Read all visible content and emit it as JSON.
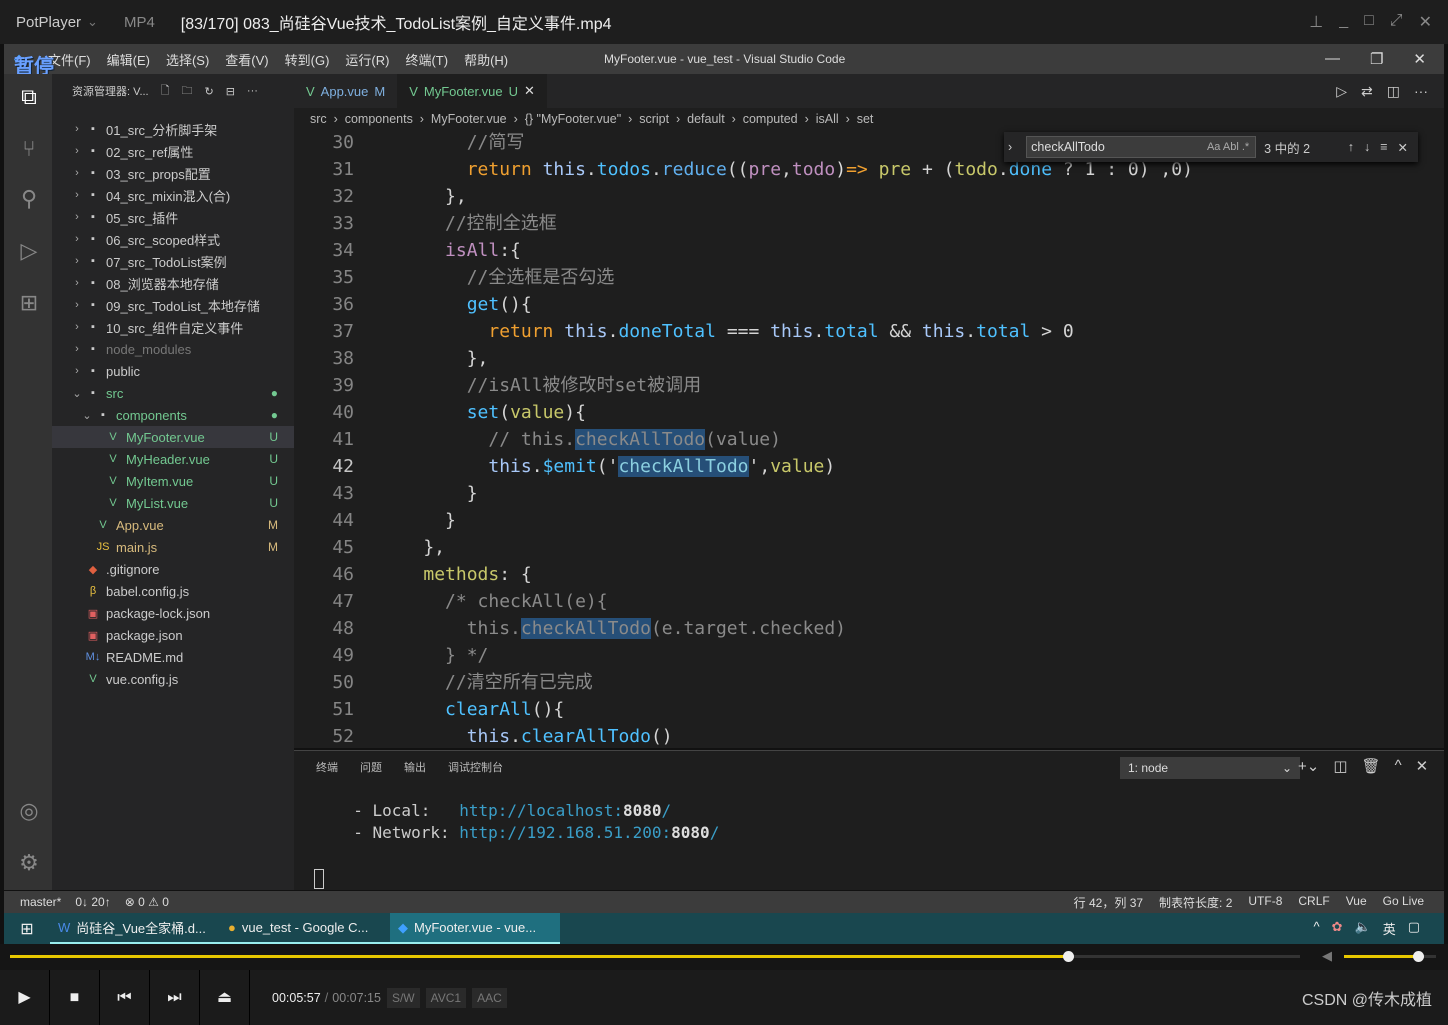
{
  "player": {
    "brand": "PotPlayer",
    "format": "MP4",
    "title": "[83/170] 083_尚硅谷Vue技术_TodoList案例_自定义事件.mp4",
    "pause_overlay": "暂停",
    "time_current": "00:05:57",
    "time_total": "00:07:15",
    "badges": [
      "S/W",
      "AVC1",
      "AAC"
    ],
    "progress_fraction": 0.82,
    "volume_fraction": 0.8,
    "watermark": "CSDN @传木成植",
    "accent": "#e8c800"
  },
  "vscode": {
    "menu": [
      "文件(F)",
      "编辑(E)",
      "选择(S)",
      "查看(V)",
      "转到(G)",
      "运行(R)",
      "终端(T)",
      "帮助(H)"
    ],
    "window_title": "MyFooter.vue - vue_test - Visual Studio Code",
    "explorer_title": "资源管理器: V...",
    "files": [
      {
        "label": "01_src_分析脚手架",
        "type": "folder",
        "level": 0
      },
      {
        "label": "02_src_ref属性",
        "type": "folder",
        "level": 0
      },
      {
        "label": "03_src_props配置",
        "type": "folder",
        "level": 0
      },
      {
        "label": "04_src_mixin混入(合)",
        "type": "folder",
        "level": 0
      },
      {
        "label": "05_src_插件",
        "type": "folder",
        "level": 0
      },
      {
        "label": "06_src_scoped样式",
        "type": "folder",
        "level": 0
      },
      {
        "label": "07_src_TodoList案例",
        "type": "folder",
        "level": 0
      },
      {
        "label": "08_浏览器本地存储",
        "type": "folder",
        "level": 0
      },
      {
        "label": "09_src_TodoList_本地存储",
        "type": "folder",
        "level": 0
      },
      {
        "label": "10_src_组件自定义事件",
        "type": "folder",
        "level": 0
      },
      {
        "label": "node_modules",
        "type": "folder",
        "level": 0,
        "dim": true
      },
      {
        "label": "public",
        "type": "folder",
        "level": 0
      },
      {
        "label": "src",
        "type": "folder-open",
        "level": 0,
        "badge": "●",
        "color": "green"
      },
      {
        "label": "components",
        "type": "folder-open",
        "level": 1,
        "badge": "●",
        "color": "green"
      },
      {
        "label": "MyFooter.vue",
        "type": "vue",
        "level": 2,
        "badge": "U",
        "color": "green",
        "selected": true
      },
      {
        "label": "MyHeader.vue",
        "type": "vue",
        "level": 2,
        "badge": "U",
        "color": "green"
      },
      {
        "label": "MyItem.vue",
        "type": "vue",
        "level": 2,
        "badge": "U",
        "color": "green"
      },
      {
        "label": "MyList.vue",
        "type": "vue",
        "level": 2,
        "badge": "U",
        "color": "green"
      },
      {
        "label": "App.vue",
        "type": "vue",
        "level": 1,
        "badge": "M",
        "color": "mod"
      },
      {
        "label": "main.js",
        "type": "js",
        "level": 1,
        "badge": "M",
        "color": "mod"
      },
      {
        "label": ".gitignore",
        "type": "git",
        "level": 0
      },
      {
        "label": "babel.config.js",
        "type": "babel",
        "level": 0
      },
      {
        "label": "package-lock.json",
        "type": "json",
        "level": 0
      },
      {
        "label": "package.json",
        "type": "json",
        "level": 0
      },
      {
        "label": "README.md",
        "type": "md",
        "level": 0
      },
      {
        "label": "vue.config.js",
        "type": "vue",
        "level": 0
      }
    ],
    "tabs": [
      {
        "label": "App.vue",
        "badge": "M"
      },
      {
        "label": "MyFooter.vue",
        "badge": "U",
        "active": true
      }
    ],
    "breadcrumb": [
      "src",
      "components",
      "MyFooter.vue",
      "{} \"MyFooter.vue\"",
      "script",
      "default",
      "computed",
      "isAll",
      "set"
    ],
    "find": {
      "value": "checkAllTodo",
      "options": "Aa  Abl  .*",
      "result": "3 中的 2"
    },
    "code": [
      {
        "n": "30",
        "t": [
          [
            "        "
          ],
          [
            "//简写",
            "c"
          ]
        ]
      },
      {
        "n": "31",
        "t": [
          [
            "        "
          ],
          [
            "return ",
            "k"
          ],
          [
            "this",
            "t"
          ],
          [
            "."
          ],
          [
            "todos",
            "p"
          ],
          [
            "."
          ],
          [
            "reduce",
            "f"
          ],
          [
            "(("
          ],
          [
            "pre",
            "v"
          ],
          [
            ","
          ],
          [
            "todo",
            "v"
          ],
          [
            ")",
            "o"
          ],
          [
            "=>",
            "k"
          ],
          [
            " "
          ],
          [
            "pre",
            "y"
          ],
          [
            " + ("
          ],
          [
            "todo",
            "y"
          ],
          [
            "."
          ],
          [
            "done",
            "p"
          ],
          [
            " ? 1 : 0) ,0)"
          ]
        ]
      },
      {
        "n": "32",
        "t": [
          [
            "      },"
          ]
        ]
      },
      {
        "n": "33",
        "t": [
          [
            "      "
          ],
          [
            "//控制全选框",
            "c"
          ]
        ]
      },
      {
        "n": "34",
        "t": [
          [
            "      "
          ],
          [
            "isAll",
            "v"
          ],
          [
            ":{"
          ]
        ]
      },
      {
        "n": "35",
        "t": [
          [
            "        "
          ],
          [
            "//全选框是否勾选",
            "c"
          ]
        ]
      },
      {
        "n": "36",
        "t": [
          [
            "        "
          ],
          [
            "get",
            "p"
          ],
          [
            "(){"
          ]
        ]
      },
      {
        "n": "37",
        "t": [
          [
            "          "
          ],
          [
            "return ",
            "k"
          ],
          [
            "this",
            "t"
          ],
          [
            "."
          ],
          [
            "doneTotal",
            "p"
          ],
          [
            " === "
          ],
          [
            "this",
            "t"
          ],
          [
            "."
          ],
          [
            "total",
            "p"
          ],
          [
            " && "
          ],
          [
            "this",
            "t"
          ],
          [
            "."
          ],
          [
            "total",
            "p"
          ],
          [
            " > 0"
          ]
        ]
      },
      {
        "n": "38",
        "t": [
          [
            "        },"
          ]
        ]
      },
      {
        "n": "39",
        "t": [
          [
            "        "
          ],
          [
            "//isAll被修改时set被调用",
            "c"
          ]
        ]
      },
      {
        "n": "40",
        "t": [
          [
            "        "
          ],
          [
            "set",
            "p"
          ],
          [
            "("
          ],
          [
            "value",
            "y"
          ],
          [
            "){"
          ]
        ]
      },
      {
        "n": "41",
        "t": [
          [
            "          "
          ],
          [
            "// this.",
            "c"
          ],
          [
            "checkAllTodo",
            "c h"
          ],
          [
            "(value)",
            "c"
          ]
        ]
      },
      {
        "n": "42",
        "t": [
          [
            "          "
          ],
          [
            "this",
            "t"
          ],
          [
            "."
          ],
          [
            "$emit",
            "p"
          ],
          [
            "('"
          ],
          [
            "checkAllTodo",
            "s h"
          ],
          [
            "',"
          ],
          [
            "value",
            "y"
          ],
          [
            ")"
          ]
        ],
        "current": true
      },
      {
        "n": "43",
        "t": [
          [
            "        }"
          ]
        ]
      },
      {
        "n": "44",
        "t": [
          [
            "      }"
          ]
        ]
      },
      {
        "n": "45",
        "t": [
          [
            "    },"
          ]
        ]
      },
      {
        "n": "46",
        "t": [
          [
            "    "
          ],
          [
            "methods",
            "y"
          ],
          [
            ": {"
          ]
        ]
      },
      {
        "n": "47",
        "t": [
          [
            "      "
          ],
          [
            "/* checkAll(e){",
            "c"
          ]
        ]
      },
      {
        "n": "48",
        "t": [
          [
            "        "
          ],
          [
            "this.",
            "c"
          ],
          [
            "checkAllTodo",
            "c h"
          ],
          [
            "(e.target.checked)",
            "c"
          ]
        ]
      },
      {
        "n": "49",
        "t": [
          [
            "      "
          ],
          [
            "} */",
            "c"
          ]
        ]
      },
      {
        "n": "50",
        "t": [
          [
            "      "
          ],
          [
            "//清空所有已完成",
            "c"
          ]
        ]
      },
      {
        "n": "51",
        "t": [
          [
            "      "
          ],
          [
            "clearAll",
            "p"
          ],
          [
            "(){"
          ]
        ]
      },
      {
        "n": "52",
        "t": [
          [
            "        "
          ],
          [
            "this",
            "t"
          ],
          [
            "."
          ],
          [
            "clearAllTodo",
            "p"
          ],
          [
            "()"
          ]
        ]
      }
    ],
    "panel": {
      "tabs": [
        "终端",
        "问题",
        "输出",
        "调试控制台"
      ],
      "terminal_select": "1: node",
      "lines": [
        {
          "label": "  - Local:   ",
          "url": "http://localhost:",
          "port": "8080",
          "tail": "/"
        },
        {
          "label": "  - Network: ",
          "url": "http://192.168.51.200:",
          "port": "8080",
          "tail": "/"
        }
      ]
    },
    "status": {
      "branch": "master*",
      "sync": "0↓ 20↑",
      "problems": "⊗ 0 ⚠ 0",
      "right": [
        "行 42，列 37",
        "制表符长度: 2",
        "UTF-8",
        "CRLF",
        "Vue",
        "Go Live"
      ]
    }
  },
  "taskbar": {
    "items": [
      "尚硅谷_Vue全家桶.d...",
      "vue_test - Google C...",
      "MyFooter.vue - vue..."
    ],
    "ime": "英"
  }
}
